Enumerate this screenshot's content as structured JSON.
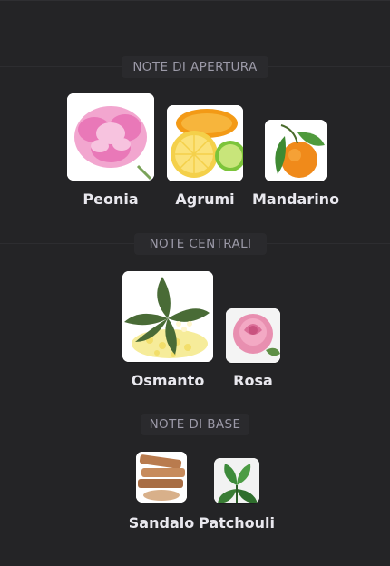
{
  "sections": [
    {
      "title": "NOTE DI APERTURA",
      "notes": [
        {
          "name": "Peonia",
          "icon": "peony-flower-icon"
        },
        {
          "name": "Agrumi",
          "icon": "citrus-fruit-icon"
        },
        {
          "name": "Mandarino",
          "icon": "mandarin-orange-icon"
        }
      ]
    },
    {
      "title": "NOTE CENTRALI",
      "notes": [
        {
          "name": "Osmanto",
          "icon": "osmanthus-flower-icon"
        },
        {
          "name": "Rosa",
          "icon": "rose-flower-icon"
        }
      ]
    },
    {
      "title": "NOTE DI BASE",
      "notes": [
        {
          "name": "Sandalo",
          "icon": "sandalwood-icon"
        },
        {
          "name": "Patchouli",
          "icon": "patchouli-leaf-icon"
        }
      ]
    }
  ],
  "colors": {
    "background": "#242426",
    "section_title": "#9c9aa8",
    "label": "#e9e8ee"
  }
}
